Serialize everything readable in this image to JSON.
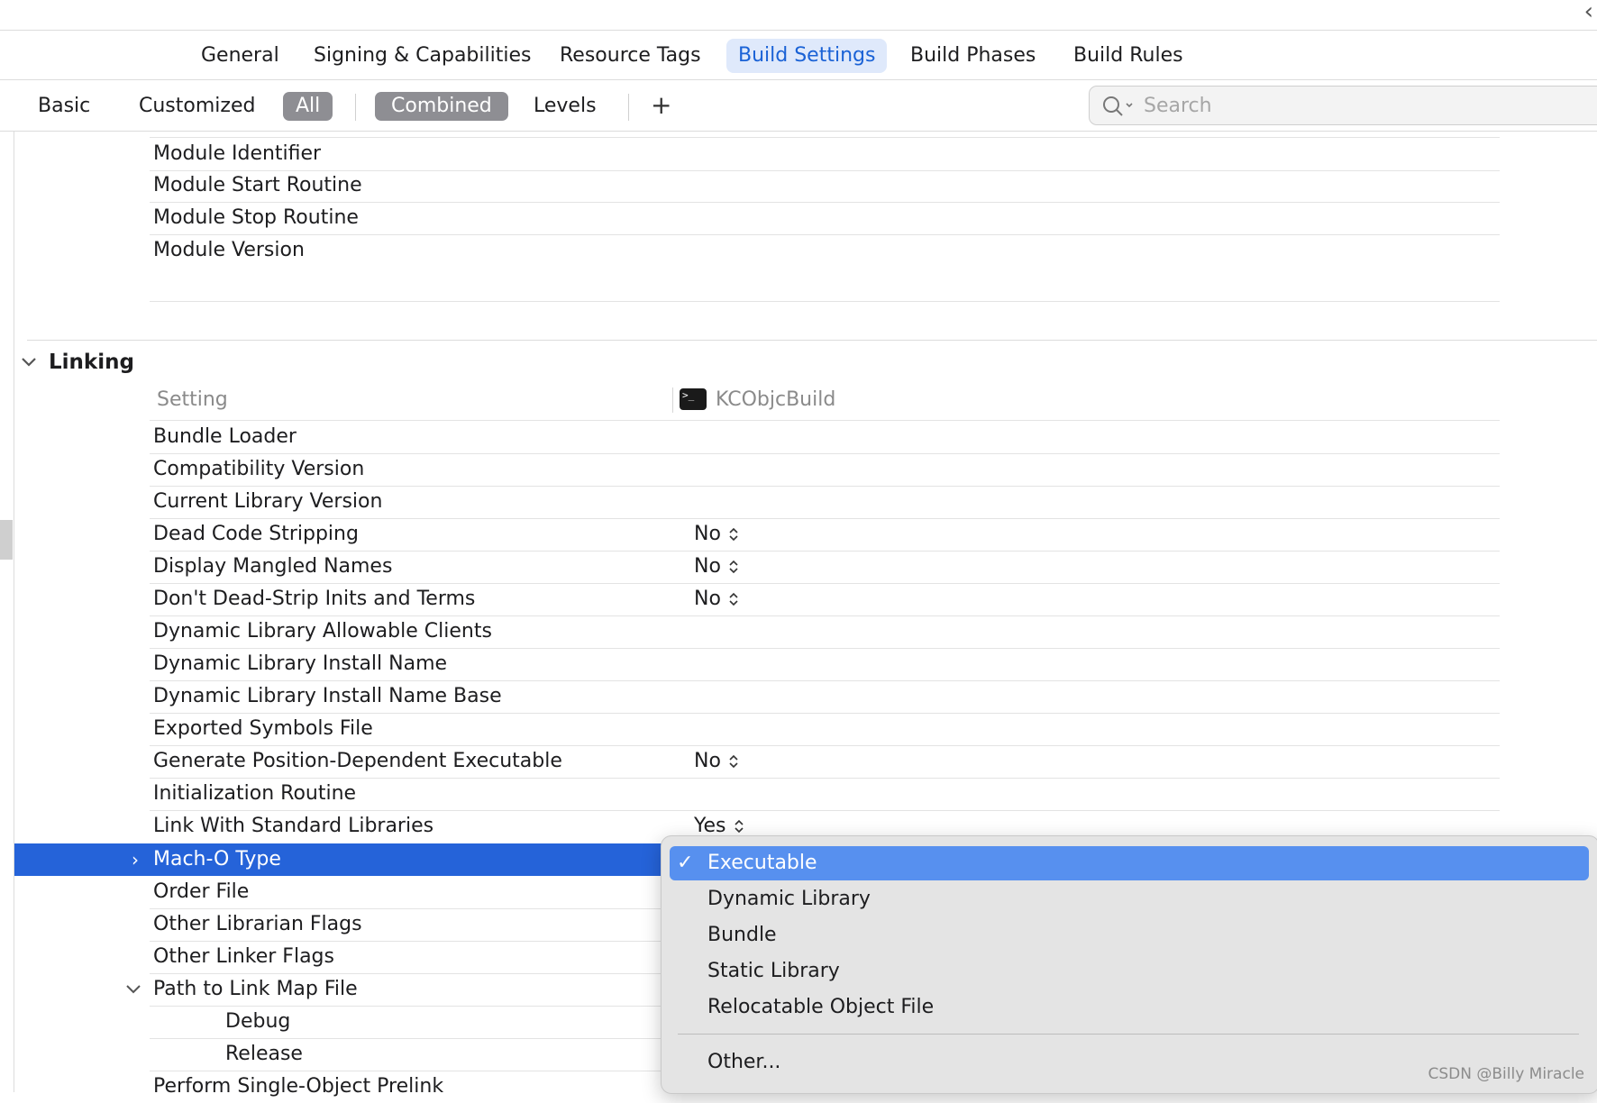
{
  "window": {
    "back_glyph": "‹"
  },
  "tabs": [
    {
      "label": "General"
    },
    {
      "label": "Signing & Capabilities"
    },
    {
      "label": "Resource Tags"
    },
    {
      "label": "Build Settings",
      "active": true
    },
    {
      "label": "Build Phases"
    },
    {
      "label": "Build Rules"
    }
  ],
  "filter": {
    "basic": "Basic",
    "customized": "Customized",
    "all": "All",
    "combined": "Combined",
    "levels": "Levels",
    "add": "+",
    "search_placeholder": "Search"
  },
  "module_rows": [
    {
      "label": "Module Identifier"
    },
    {
      "label": "Module Start Routine"
    },
    {
      "label": "Module Stop Routine"
    },
    {
      "label": "Module Version"
    }
  ],
  "linking": {
    "title": "Linking",
    "header_setting": "Setting",
    "target_icon_glyph": ">_",
    "target_name": "KCObjcBuild",
    "rows": [
      {
        "label": "Bundle Loader",
        "value": ""
      },
      {
        "label": "Compatibility Version",
        "value": ""
      },
      {
        "label": "Current Library Version",
        "value": ""
      },
      {
        "label": "Dead Code Stripping",
        "value": "No"
      },
      {
        "label": "Display Mangled Names",
        "value": "No"
      },
      {
        "label": "Don't Dead-Strip Inits and Terms",
        "value": "No"
      },
      {
        "label": "Dynamic Library Allowable Clients",
        "value": ""
      },
      {
        "label": "Dynamic Library Install Name",
        "value": ""
      },
      {
        "label": "Dynamic Library Install Name Base",
        "value": ""
      },
      {
        "label": "Exported Symbols File",
        "value": ""
      },
      {
        "label": "Generate Position-Dependent Executable",
        "value": "No"
      },
      {
        "label": "Initialization Routine",
        "value": ""
      },
      {
        "label": "Link With Standard Libraries",
        "value": "Yes"
      }
    ],
    "selected_row": {
      "label": "Mach-O Type"
    },
    "rows_after": [
      {
        "label": "Order File"
      },
      {
        "label": "Other Librarian Flags"
      },
      {
        "label": "Other Linker Flags"
      },
      {
        "label": "Path to Link Map File"
      },
      {
        "label": "Debug"
      },
      {
        "label": "Release"
      },
      {
        "label": "Perform Single-Object Prelink"
      }
    ]
  },
  "menu": {
    "check": "✓",
    "items": [
      {
        "label": "Executable",
        "selected": true
      },
      {
        "label": "Dynamic Library"
      },
      {
        "label": "Bundle"
      },
      {
        "label": "Static Library"
      },
      {
        "label": "Relocatable Object File"
      },
      {
        "label": "Other..."
      }
    ]
  },
  "watermark": "CSDN @Billy Miracle",
  "colors": {
    "accent": "#2563d9",
    "menu_highlight": "#5790ef",
    "tab_active_bg": "#dfe9fb"
  }
}
